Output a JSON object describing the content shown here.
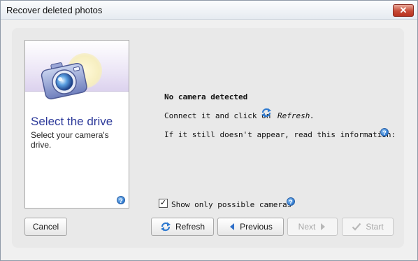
{
  "window": {
    "title": "Recover deleted photos",
    "close_label": "✕"
  },
  "card": {
    "title": "Select the drive",
    "subtitle": "Select your camera's drive.",
    "help_glyph": "?"
  },
  "message": {
    "title": "No camera detected",
    "line1": "Connect it and click on",
    "refresh_link": "Refresh.",
    "line2": "If it still doesn't appear, read this information:",
    "help_glyph": "?"
  },
  "filter": {
    "checked": true,
    "check_glyph": "✓",
    "label": "Show only possible cameras",
    "help_glyph": "?"
  },
  "buttons": {
    "cancel": "Cancel",
    "refresh": "Refresh",
    "previous": "Previous",
    "next": "Next",
    "start": "Start"
  },
  "colors": {
    "title_accent": "#2d3a9a",
    "help_blue": "#2f7ad0",
    "disabled_text": "#a8a8a8"
  }
}
